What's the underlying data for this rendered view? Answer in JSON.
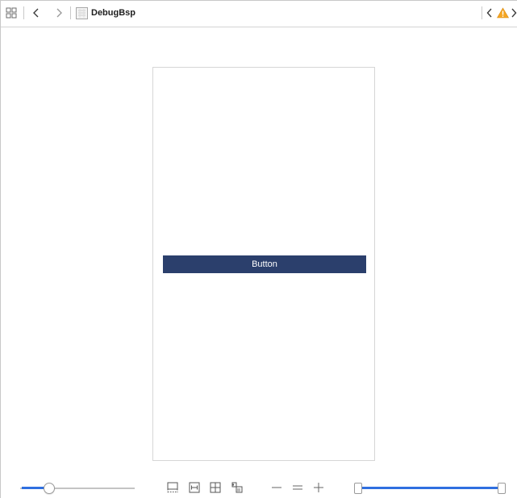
{
  "jumpbar": {
    "related_items_icon": "grid-icon",
    "back_icon": "chevron-left-icon",
    "forward_icon": "chevron-right-icon",
    "file_icon": "storyboard-file-icon",
    "title": "DebugBsp",
    "issue_prev_icon": "chevron-left-icon",
    "warning_icon": "warning-triangle-icon",
    "warning_color": "#f5a623"
  },
  "canvas": {
    "scene_button_label": "Button",
    "button_color": "#2b3f6c"
  },
  "bottombar": {
    "left_slider_icon": "slider",
    "left_slider_value": 0.23,
    "layout_icons": [
      "embed-in-icon",
      "align-icon",
      "pin-icon",
      "resolve-issues-icon"
    ],
    "zoom_icons": [
      "zoom-out-icon",
      "zoom-actual-icon",
      "zoom-in-icon"
    ],
    "right_slider_value": 1.0,
    "accent_color": "#2f6fe0"
  }
}
